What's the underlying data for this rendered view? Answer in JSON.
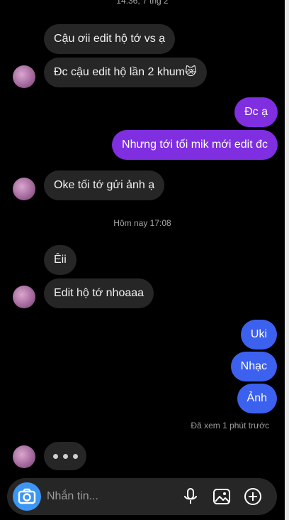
{
  "thread": {
    "timestamp_top": "14:36, 7 thg 2",
    "messages_1": [
      {
        "text": "Cậu ơii edit hộ tớ vs ạ"
      },
      {
        "text": "Đc cậu edit hộ lần 2 khum😿"
      }
    ],
    "me_1": [
      {
        "text": "Đc ạ"
      },
      {
        "text": "Nhưng tới tối mik mới edit đc"
      }
    ],
    "messages_2": [
      {
        "text": "Oke tối tớ gửi ảnh ạ"
      }
    ],
    "timestamp_today": "Hôm nay 17:08",
    "messages_3": [
      {
        "text": "Êii"
      },
      {
        "text": "Edit hộ tớ nhoaaa"
      }
    ],
    "me_2": [
      {
        "text": "Uki"
      },
      {
        "text": "Nhạc"
      },
      {
        "text": "Ảnh"
      }
    ],
    "seen": "Đã xem 1 phút trước"
  },
  "composer": {
    "placeholder": "Nhắn tin...",
    "icons": [
      "camera-icon",
      "microphone-icon",
      "image-icon",
      "add-icon"
    ]
  },
  "colors": {
    "background": "#000000",
    "incoming_bubble": "#262626",
    "outgoing_purple": "#7f2ee0",
    "outgoing_blue": "#3c61ee",
    "camera_button": "#3b97f3"
  }
}
